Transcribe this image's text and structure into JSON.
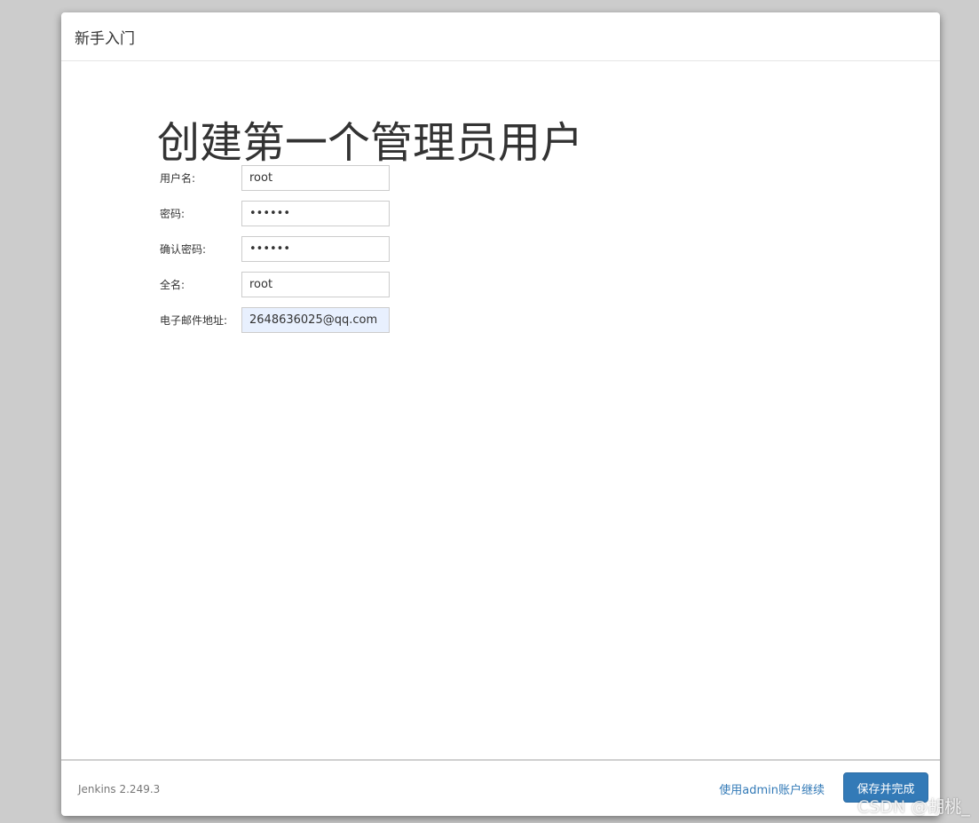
{
  "header": {
    "title": "新手入门"
  },
  "main": {
    "title": "创建第一个管理员用户",
    "fields": [
      {
        "label": "用户名:",
        "value": "root",
        "type": "text"
      },
      {
        "label": "密码:",
        "value": "......",
        "type": "password"
      },
      {
        "label": "确认密码:",
        "value": "......",
        "type": "password"
      },
      {
        "label": "全名:",
        "value": "root",
        "type": "text"
      },
      {
        "label": "电子邮件地址:",
        "value": "2648636025@qq.com",
        "type": "text"
      }
    ]
  },
  "footer": {
    "version": "Jenkins 2.249.3",
    "continue_admin": "使用admin账户继续",
    "save_finish": "保存并完成"
  },
  "watermark": "CSDN @胡桃_"
}
